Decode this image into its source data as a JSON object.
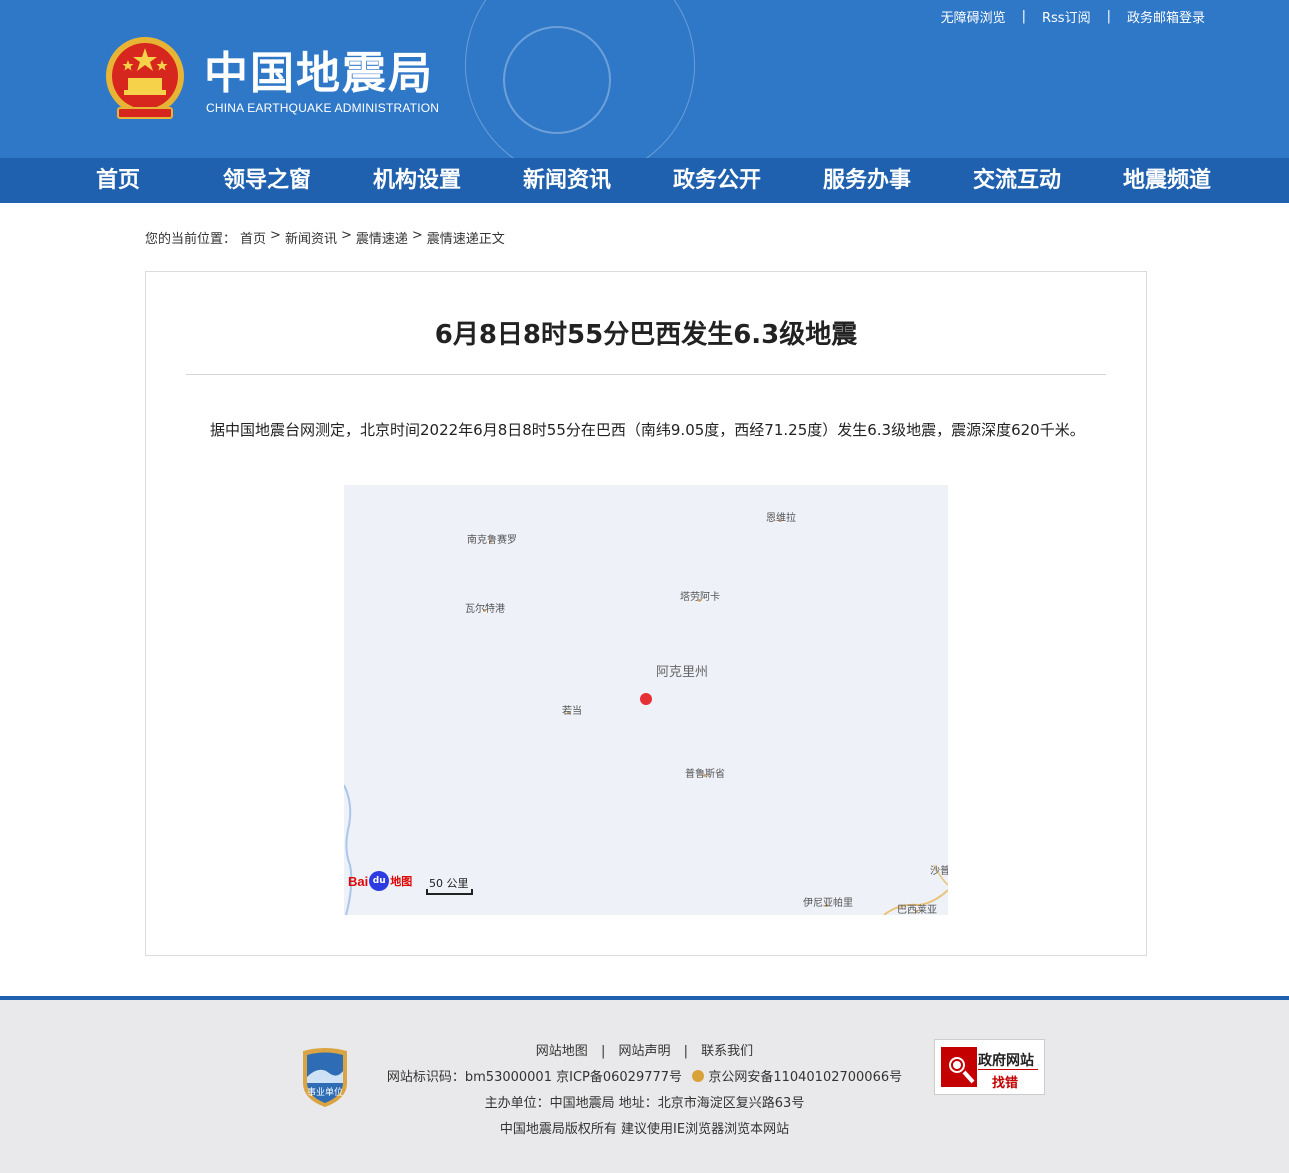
{
  "header": {
    "logo_cn": "中国地震局",
    "logo_en": "CHINA EARTHQUAKE ADMINISTRATION",
    "toplinks": [
      "无障碍浏览",
      "Rss订阅",
      "政务邮箱登录"
    ],
    "separator": "|"
  },
  "nav": {
    "items": [
      "首页",
      "领导之窗",
      "机构设置",
      "新闻资讯",
      "政务公开",
      "服务办事",
      "交流互动",
      "地震频道"
    ]
  },
  "breadcrumb": {
    "prefix": "您的当前位置：",
    "items": [
      "首页",
      "新闻资讯",
      "震情速递",
      "震情速递正文"
    ],
    "separator": ">"
  },
  "article": {
    "title": "6月8日8时55分巴西发生6.3级地震",
    "body": "据中国地震台网测定，北京时间2022年6月8日8时55分在巴西（南纬9.05度，西经71.25度）发生6.3级地震，震源深度620千米。"
  },
  "map": {
    "places": [
      "恩维拉",
      "南克鲁赛罗",
      "塔劳阿卡",
      "瓦尔特港",
      "若当",
      "普鲁斯省",
      "沙普",
      "伊尼亚帕里",
      "巴西莱亚"
    ],
    "region": "阿克里州",
    "scale": "50 公里",
    "brand_left": "Bai",
    "brand_paw": "du",
    "brand_right": "地图"
  },
  "footer": {
    "links": [
      "网站地图",
      "网站声明",
      "联系我们"
    ],
    "separator": "|",
    "line1": "网站标识码：bm53000001   京ICP备06029777号",
    "line1_police": "京公网安备11040102700066号",
    "line2": "主办单位：中国地震局   地址：北京市海淀区复兴路63号",
    "line3": "中国地震局版权所有   建议使用IE浏览器浏览本网站",
    "badge_text": "事业单位",
    "jiucuo_line1": "政府网站",
    "jiucuo_line2": "找错"
  },
  "colors": {
    "header_bg": "#2f78c8",
    "nav_bg": "#1f61ae",
    "quake_marker": "#e53036"
  }
}
